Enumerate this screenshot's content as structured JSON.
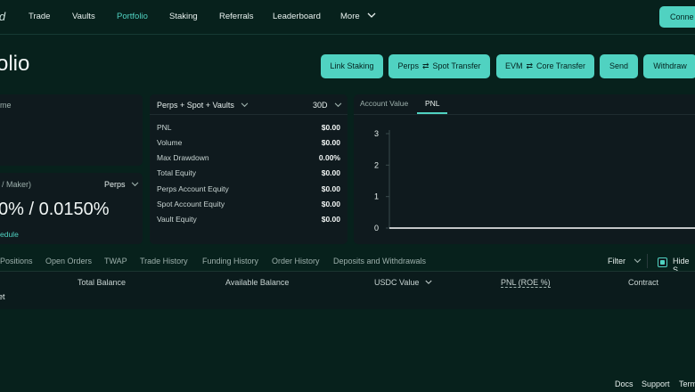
{
  "nav": {
    "logo_text": "id",
    "items": [
      {
        "label": "Trade"
      },
      {
        "label": "Vaults"
      },
      {
        "label": "Portfolio"
      },
      {
        "label": "Staking"
      },
      {
        "label": "Referrals"
      },
      {
        "label": "Leaderboard"
      },
      {
        "label": "More"
      }
    ],
    "connect_label": "Conne"
  },
  "page": {
    "title": "olio",
    "buttons": {
      "link_staking": "Link Staking",
      "perps": "Perps",
      "spot_transfer": "Spot Transfer",
      "evm": "EVM",
      "core_transfer": "Core Transfer",
      "send": "Send",
      "withdraw": "Withdraw"
    }
  },
  "volume_panel": {
    "label": "me"
  },
  "fees_panel": {
    "label": "/ Maker)",
    "selector": "Perps",
    "rates": "0% / 0.0150%",
    "link": "edule"
  },
  "summary_panel": {
    "selector": "Perps + Spot + Vaults",
    "period": "30D",
    "rows": [
      {
        "label": "PNL",
        "value": "$0.00"
      },
      {
        "label": "Volume",
        "value": "$0.00"
      },
      {
        "label": "Max Drawdown",
        "value": "0.00%"
      },
      {
        "label": "Total Equity",
        "value": "$0.00"
      },
      {
        "label": "Perps Account Equity",
        "value": "$0.00"
      },
      {
        "label": "Spot Account Equity",
        "value": "$0.00"
      },
      {
        "label": "Vault Equity",
        "value": "$0.00"
      }
    ]
  },
  "chart_panel": {
    "tabs": [
      "Account Value",
      "PNL"
    ],
    "active_tab": "PNL"
  },
  "chart_data": {
    "type": "line",
    "x": [
      0,
      1
    ],
    "series": [
      {
        "values": [
          0,
          0
        ]
      }
    ],
    "yticks": [
      "3",
      "2",
      "1",
      "0"
    ],
    "ylim": [
      0,
      3
    ],
    "title": "",
    "xlabel": "",
    "ylabel": ""
  },
  "bottom": {
    "tabs": [
      "Positions",
      "Open Orders",
      "TWAP",
      "Trade History",
      "Funding History",
      "Order History",
      "Deposits and Withdrawals"
    ],
    "filter_label": "Filter",
    "hide_label": "Hide S",
    "columns": [
      "Total Balance",
      "Available Balance",
      "USDC Value",
      "PNL (ROE %)",
      "Contract"
    ],
    "row_label": "et"
  },
  "footer": {
    "links": [
      "Docs",
      "Support",
      "Term"
    ]
  },
  "colors": {
    "accent": "#50d2c1",
    "background": "#07211c",
    "panel": "#0f1a1e"
  }
}
